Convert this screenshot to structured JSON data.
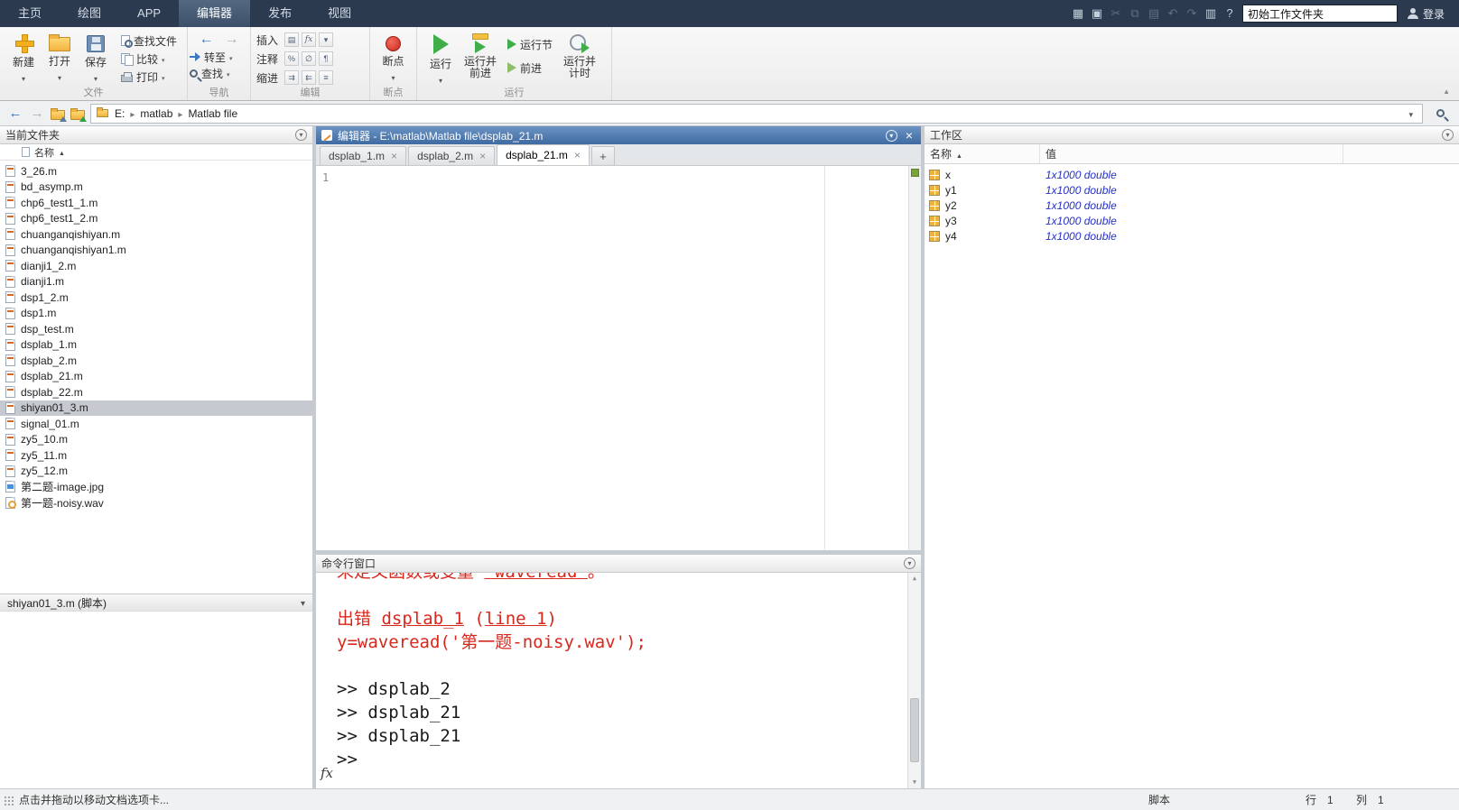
{
  "titlebar": {
    "tabs": [
      {
        "label": "主页",
        "active": false
      },
      {
        "label": "绘图",
        "active": false
      },
      {
        "label": "APP",
        "active": false
      },
      {
        "label": "编辑器",
        "active": true
      },
      {
        "label": "发布",
        "active": false
      },
      {
        "label": "视图",
        "active": false
      }
    ],
    "quick_icons": [
      {
        "name": "screenshot-icon",
        "glyph": "▦",
        "enabled": true
      },
      {
        "name": "save-icon",
        "glyph": "▣",
        "enabled": true
      },
      {
        "name": "cut-icon",
        "glyph": "✂",
        "enabled": false
      },
      {
        "name": "copy-icon",
        "glyph": "⧉",
        "enabled": false
      },
      {
        "name": "paste-icon",
        "glyph": "▤",
        "enabled": false
      },
      {
        "name": "undo-icon",
        "glyph": "↶",
        "enabled": false
      },
      {
        "name": "redo-icon",
        "glyph": "↷",
        "enabled": false
      },
      {
        "name": "desktop-layout-icon",
        "glyph": "▥",
        "enabled": true
      },
      {
        "name": "help-icon",
        "glyph": "?",
        "enabled": true
      }
    ],
    "search_value": "初始工作文件夹",
    "login_label": "登录"
  },
  "ribbon": {
    "sections": {
      "file": {
        "label": "文件"
      },
      "navigate": {
        "label": "导航"
      },
      "edit": {
        "label": "编辑"
      },
      "breakpoints": {
        "label": "断点"
      },
      "run": {
        "label": "运行"
      }
    },
    "buttons": {
      "new": "新建",
      "open": "打开",
      "save": "保存",
      "find_files": "查找文件",
      "compare": "比较",
      "print": "打印",
      "goto": "转至",
      "find": "查找",
      "insert": "插入",
      "comment": "注释",
      "indent": "缩进",
      "breakpoints": "断点",
      "run": "运行",
      "run_advance_line1": "运行并",
      "run_advance_line2": "前进",
      "run_section": "运行节",
      "advance": "前进",
      "run_time_line1": "运行并",
      "run_time_line2": "计时"
    }
  },
  "addressbar": {
    "path": [
      "E:",
      "matlab",
      "Matlab file"
    ]
  },
  "current_folder": {
    "title": "当前文件夹",
    "name_column": "名称",
    "selected": "shiyan01_3.m",
    "details_label": "shiyan01_3.m (脚本)",
    "files": [
      {
        "name": "3_26.m",
        "type": "m"
      },
      {
        "name": "bd_asymp.m",
        "type": "m"
      },
      {
        "name": "chp6_test1_1.m",
        "type": "m"
      },
      {
        "name": "chp6_test1_2.m",
        "type": "m"
      },
      {
        "name": "chuanganqishiyan.m",
        "type": "m"
      },
      {
        "name": "chuanganqishiyan1.m",
        "type": "m"
      },
      {
        "name": "dianji1_2.m",
        "type": "m"
      },
      {
        "name": "dianji1.m",
        "type": "m"
      },
      {
        "name": "dsp1_2.m",
        "type": "m"
      },
      {
        "name": "dsp1.m",
        "type": "m"
      },
      {
        "name": "dsp_test.m",
        "type": "m"
      },
      {
        "name": "dsplab_1.m",
        "type": "m"
      },
      {
        "name": "dsplab_2.m",
        "type": "m"
      },
      {
        "name": "dsplab_21.m",
        "type": "m"
      },
      {
        "name": "dsplab_22.m",
        "type": "m"
      },
      {
        "name": "shiyan01_3.m",
        "type": "m"
      },
      {
        "name": "signal_01.m",
        "type": "m"
      },
      {
        "name": "zy5_10.m",
        "type": "m"
      },
      {
        "name": "zy5_11.m",
        "type": "m"
      },
      {
        "name": "zy5_12.m",
        "type": "m"
      },
      {
        "name": "第二题-image.jpg",
        "type": "image"
      },
      {
        "name": "第一题-noisy.wav",
        "type": "audio"
      }
    ]
  },
  "editor": {
    "title": "编辑器 - E:\\matlab\\Matlab file\\dsplab_21.m",
    "tabs": [
      {
        "label": "dsplab_1.m",
        "active": false
      },
      {
        "label": "dsplab_2.m",
        "active": false
      },
      {
        "label": "dsplab_21.m",
        "active": true
      }
    ],
    "new_tab_label": "+",
    "line_number": "1"
  },
  "command_window": {
    "title": "命令行窗口",
    "fx_label": "fx",
    "lines": [
      {
        "cls": "clipped",
        "parts": [
          {
            "t": "未定义函数或变量 ",
            "s": "err"
          },
          {
            "t": "'waveread'",
            "s": "errlink"
          },
          {
            "t": "。",
            "s": "err"
          }
        ]
      },
      {
        "parts": []
      },
      {
        "parts": [
          {
            "t": "出错 ",
            "s": "err"
          },
          {
            "t": "dsplab_1",
            "s": "errlink"
          },
          {
            "t": " (",
            "s": "err"
          },
          {
            "t": "line 1",
            "s": "errlink"
          },
          {
            "t": ")",
            "s": "err"
          }
        ]
      },
      {
        "parts": [
          {
            "t": "y=waveread('第一题-noisy.wav');",
            "s": "err"
          }
        ]
      },
      {
        "parts": []
      },
      {
        "parts": [
          {
            "t": ">> dsplab_2",
            "s": "cmd"
          }
        ]
      },
      {
        "parts": [
          {
            "t": ">> dsplab_21",
            "s": "cmd"
          }
        ]
      },
      {
        "parts": [
          {
            "t": ">> dsplab_21",
            "s": "cmd"
          }
        ]
      },
      {
        "parts": [
          {
            "t": ">>",
            "s": "cmd"
          }
        ]
      }
    ]
  },
  "workspace": {
    "title": "工作区",
    "columns": [
      "名称",
      "值"
    ],
    "rows": [
      {
        "name": "x",
        "value": "1x1000 double"
      },
      {
        "name": "y1",
        "value": "1x1000 double"
      },
      {
        "name": "y2",
        "value": "1x1000 double"
      },
      {
        "name": "y3",
        "value": "1x1000 double"
      },
      {
        "name": "y4",
        "value": "1x1000 double"
      }
    ]
  },
  "statusbar": {
    "left": "点击并拖动以移动文档选项卡...",
    "script_label": "脚本",
    "line_label": "行",
    "line_value": "1",
    "col_label": "列",
    "col_value": "1"
  }
}
